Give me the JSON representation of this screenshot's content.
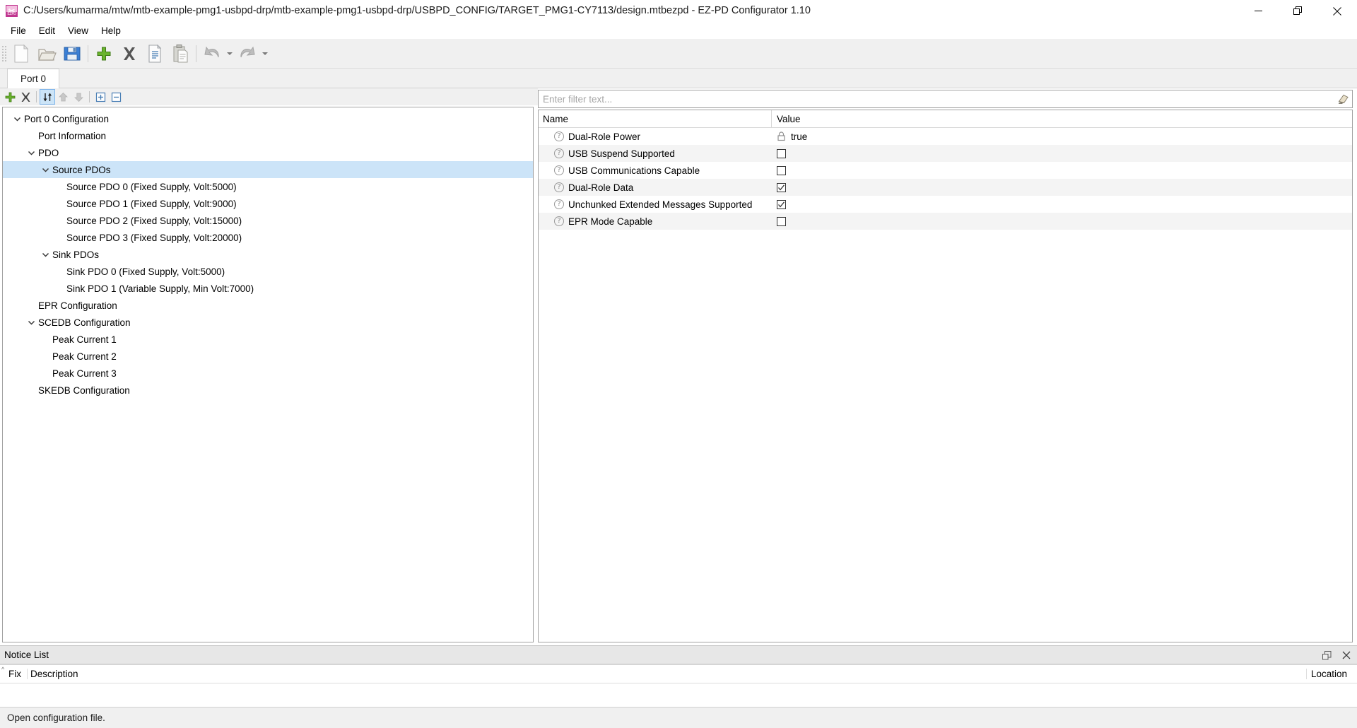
{
  "window": {
    "title": "C:/Users/kumarma/mtw/mtb-example-pmg1-usbpd-drp/mtb-example-pmg1-usbpd-drp/USBPD_CONFIG/TARGET_PMG1-CY7113/design.mtbezpd - EZ-PD Configurator 1.10",
    "app_icon_label": "EZPD",
    "minimize_label": "Minimize",
    "maximize_label": "Restore",
    "close_label": "Close"
  },
  "menubar": {
    "items": [
      {
        "label": "File"
      },
      {
        "label": "Edit"
      },
      {
        "label": "View"
      },
      {
        "label": "Help"
      }
    ]
  },
  "toolbar": {
    "buttons": [
      {
        "name": "new-file-icon",
        "tooltip": "New"
      },
      {
        "name": "open-folder-icon",
        "tooltip": "Open"
      },
      {
        "name": "save-icon",
        "tooltip": "Save"
      },
      {
        "name": "add-icon",
        "tooltip": "Add"
      },
      {
        "name": "delete-icon",
        "tooltip": "Delete"
      },
      {
        "name": "copy-icon",
        "tooltip": "Copy"
      },
      {
        "name": "paste-icon",
        "tooltip": "Paste"
      },
      {
        "name": "undo-icon",
        "tooltip": "Undo"
      },
      {
        "name": "redo-icon",
        "tooltip": "Redo"
      }
    ]
  },
  "tabs": [
    {
      "label": "Port 0",
      "active": true
    }
  ],
  "tree_toolbar": {
    "buttons": [
      {
        "name": "add-item-icon",
        "tooltip": "Add",
        "state": "enabled"
      },
      {
        "name": "remove-item-icon",
        "tooltip": "Remove",
        "state": "enabled"
      },
      {
        "name": "sort-toggle-icon",
        "tooltip": "Sort",
        "state": "active"
      },
      {
        "name": "move-up-icon",
        "tooltip": "Move Up",
        "state": "disabled"
      },
      {
        "name": "move-down-icon",
        "tooltip": "Move Down",
        "state": "disabled"
      },
      {
        "name": "expand-all-icon",
        "tooltip": "Expand All",
        "state": "enabled"
      },
      {
        "name": "collapse-all-icon",
        "tooltip": "Collapse All",
        "state": "enabled"
      }
    ]
  },
  "tree": {
    "nodes": [
      {
        "label": "Port 0 Configuration",
        "indent": 0,
        "twisty": "expanded",
        "selected": false
      },
      {
        "label": "Port Information",
        "indent": 1,
        "twisty": "none",
        "selected": false
      },
      {
        "label": "PDO",
        "indent": 1,
        "twisty": "expanded",
        "selected": false
      },
      {
        "label": "Source PDOs",
        "indent": 2,
        "twisty": "expanded",
        "selected": true
      },
      {
        "label": "Source PDO 0 (Fixed Supply, Volt:5000)",
        "indent": 3,
        "twisty": "none",
        "selected": false
      },
      {
        "label": "Source PDO 1 (Fixed Supply, Volt:9000)",
        "indent": 3,
        "twisty": "none",
        "selected": false
      },
      {
        "label": "Source PDO 2 (Fixed Supply, Volt:15000)",
        "indent": 3,
        "twisty": "none",
        "selected": false
      },
      {
        "label": "Source PDO 3 (Fixed Supply, Volt:20000)",
        "indent": 3,
        "twisty": "none",
        "selected": false
      },
      {
        "label": "Sink PDOs",
        "indent": 2,
        "twisty": "expanded",
        "selected": false
      },
      {
        "label": "Sink PDO 0 (Fixed Supply, Volt:5000)",
        "indent": 3,
        "twisty": "none",
        "selected": false
      },
      {
        "label": "Sink PDO 1 (Variable Supply, Min Volt:7000)",
        "indent": 3,
        "twisty": "none",
        "selected": false
      },
      {
        "label": "EPR Configuration",
        "indent": 1,
        "twisty": "none",
        "selected": false
      },
      {
        "label": "SCEDB Configuration",
        "indent": 1,
        "twisty": "expanded",
        "selected": false
      },
      {
        "label": "Peak Current 1",
        "indent": 2,
        "twisty": "none",
        "selected": false
      },
      {
        "label": "Peak Current 2",
        "indent": 2,
        "twisty": "none",
        "selected": false
      },
      {
        "label": "Peak Current 3",
        "indent": 2,
        "twisty": "none",
        "selected": false
      },
      {
        "label": "SKEDB Configuration",
        "indent": 1,
        "twisty": "none",
        "selected": false
      }
    ]
  },
  "filter": {
    "value": "",
    "placeholder": "Enter filter text...",
    "clear_icon": "eraser-icon"
  },
  "properties": {
    "columns": [
      "Name",
      "Value"
    ],
    "rows": [
      {
        "name": "Dual-Role Power",
        "value_type": "text",
        "value": "true",
        "locked": true
      },
      {
        "name": "USB Suspend Supported",
        "value_type": "checkbox",
        "checked": false,
        "locked": false
      },
      {
        "name": "USB Communications Capable",
        "value_type": "checkbox",
        "checked": false,
        "locked": false
      },
      {
        "name": "Dual-Role Data",
        "value_type": "checkbox",
        "checked": true,
        "locked": false
      },
      {
        "name": "Unchunked Extended Messages Supported",
        "value_type": "checkbox",
        "checked": true,
        "locked": false
      },
      {
        "name": "EPR Mode Capable",
        "value_type": "checkbox",
        "checked": false,
        "locked": false
      }
    ]
  },
  "notice_list": {
    "title": "Notice List",
    "restore_label": "Restore",
    "close_label": "Close",
    "columns": [
      "Fix",
      "Description",
      "Location"
    ],
    "rows": []
  },
  "statusbar": {
    "message": "Open configuration file."
  },
  "colors": {
    "selection": "#cce4f8",
    "toolbar_bg": "#f0f0f0",
    "accent_add": "#5aa521",
    "accent_brand": "#c0368f",
    "row_alt": "#f4f4f4"
  }
}
